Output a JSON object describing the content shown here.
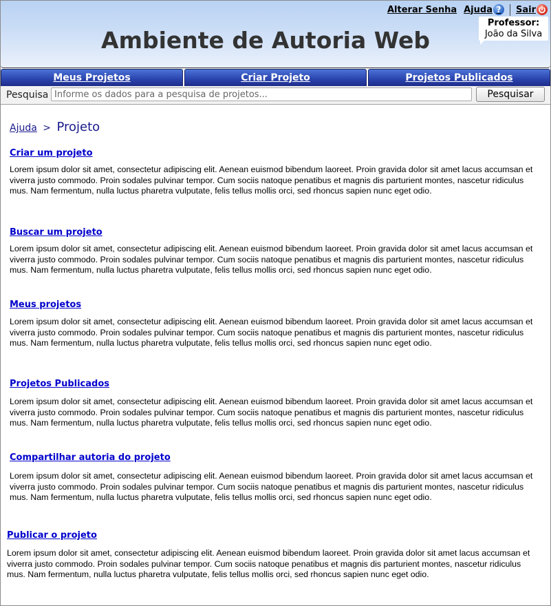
{
  "header": {
    "title": "Ambiente de Autoria Web",
    "links": {
      "alterar_senha": "Alterar Senha",
      "ajuda": "Ajuda",
      "sair": "Sair"
    },
    "professor": {
      "role": "Professor:",
      "name": "João da Silva"
    }
  },
  "nav": {
    "tabs": [
      "Meus Projetos",
      "Criar Projeto",
      "Projetos Publicados"
    ]
  },
  "search": {
    "label": "Pesquisa",
    "placeholder": "Informe os dados para a pesquisa de projetos...",
    "button": "Pesquisar"
  },
  "breadcrumb": {
    "parent": "Ajuda",
    "separator": ">",
    "current": "Projeto"
  },
  "sections": [
    {
      "title": "Criar um projeto",
      "text": "Lorem ipsum dolor sit amet, consectetur adipiscing elit. Aenean euismod bibendum laoreet. Proin gravida dolor sit amet lacus accumsan et viverra justo commodo. Proin sodales pulvinar tempor. Cum sociis natoque penatibus et magnis dis parturient montes, nascetur ridiculus mus. Nam fermentum, nulla luctus pharetra vulputate, felis tellus mollis orci, sed rhoncus sapien nunc eget odio."
    },
    {
      "title": "Buscar um projeto",
      "text": "Lorem ipsum dolor sit amet, consectetur adipiscing elit. Aenean euismod bibendum laoreet. Proin gravida dolor sit amet lacus accumsan et viverra justo commodo. Proin sodales pulvinar tempor. Cum sociis natoque penatibus et magnis dis parturient montes, nascetur ridiculus mus. Nam fermentum, nulla luctus pharetra vulputate, felis tellus mollis orci, sed rhoncus sapien nunc eget odio."
    },
    {
      "title": "Meus projetos",
      "text": "Lorem ipsum dolor sit amet, consectetur adipiscing elit. Aenean euismod bibendum laoreet. Proin gravida dolor sit amet lacus accumsan et viverra justo commodo. Proin sodales pulvinar tempor. Cum sociis natoque penatibus et magnis dis parturient montes, nascetur ridiculus mus. Nam fermentum, nulla luctus pharetra vulputate, felis tellus mollis orci, sed rhoncus sapien nunc eget odio."
    },
    {
      "title": "Projetos Publicados",
      "text": "Lorem ipsum dolor sit amet, consectetur adipiscing elit. Aenean euismod bibendum laoreet. Proin gravida dolor sit amet lacus accumsan et viverra justo commodo. Proin sodales pulvinar tempor. Cum sociis natoque penatibus et magnis dis parturient montes, nascetur ridiculus mus. Nam fermentum, nulla luctus pharetra vulputate, felis tellus mollis orci, sed rhoncus sapien nunc eget odio."
    },
    {
      "title": "Compartilhar autoria do projeto",
      "text": "Lorem ipsum dolor sit amet, consectetur adipiscing elit. Aenean euismod bibendum laoreet. Proin gravida dolor sit amet lacus accumsan et viverra justo commodo. Proin sodales pulvinar tempor. Cum sociis natoque penatibus et magnis dis parturient montes, nascetur ridiculus mus. Nam fermentum, nulla luctus pharetra vulputate, felis tellus mollis orci, sed rhoncus sapien nunc eget odio."
    },
    {
      "title": "Publicar o projeto",
      "text": "Lorem ipsum dolor sit amet, consectetur adipiscing elit. Aenean euismod bibendum laoreet. Proin gravida dolor sit amet lacus accumsan et viverra justo commodo. Proin sodales pulvinar tempor. Cum sociis natoque penatibus et magnis dis parturient montes, nascetur ridiculus mus. Nam fermentum, nulla luctus pharetra vulputate, felis tellus mollis orci, sed rhoncus sapien nunc eget odio."
    }
  ]
}
